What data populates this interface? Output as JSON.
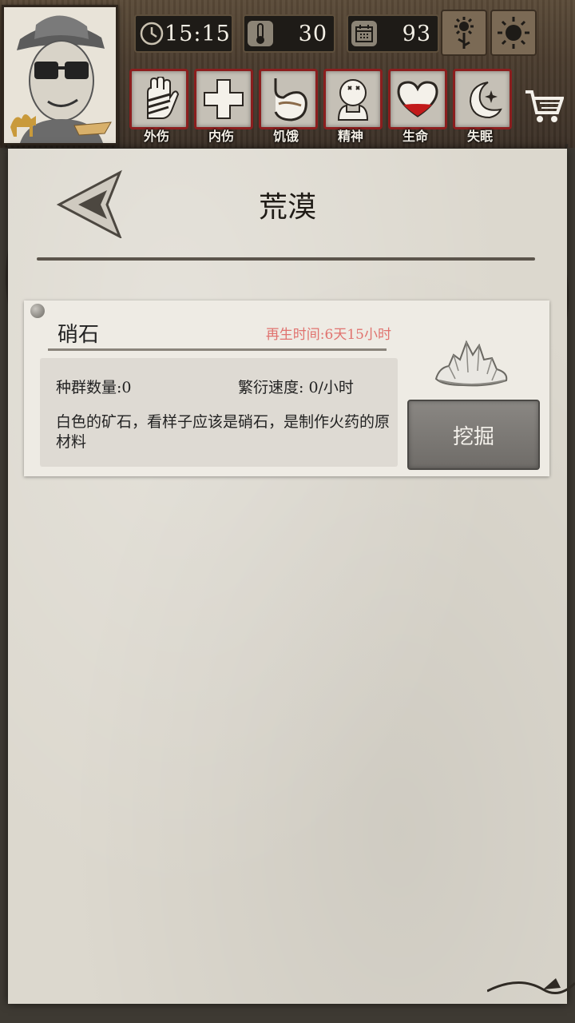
{
  "header": {
    "time": "15:15",
    "temperature": "30",
    "day": "93"
  },
  "status_icons": [
    {
      "label": "外伤",
      "icon": "bandaged-hand-icon"
    },
    {
      "label": "内伤",
      "icon": "cross-icon"
    },
    {
      "label": "饥饿",
      "icon": "stomach-icon"
    },
    {
      "label": "精神",
      "icon": "head-dizzy-icon"
    },
    {
      "label": "生命",
      "icon": "heart-icon"
    },
    {
      "label": "失眠",
      "icon": "moon-star-icon"
    }
  ],
  "page": {
    "title": "荒漠"
  },
  "resource": {
    "name": "硝石",
    "regen": "再生时间:6天15小时",
    "population": "种群数量:0",
    "growth": "繁衍速度: 0/小时",
    "description": "白色的矿石，看样子应该是硝石，是制作火药的原材料",
    "action_label": "挖掘",
    "icon": "saltpeter-crystal-icon"
  },
  "colors": {
    "status_border": "#8b1e1e",
    "regen_text": "#e0736f",
    "paper": "#dcd8ce"
  }
}
